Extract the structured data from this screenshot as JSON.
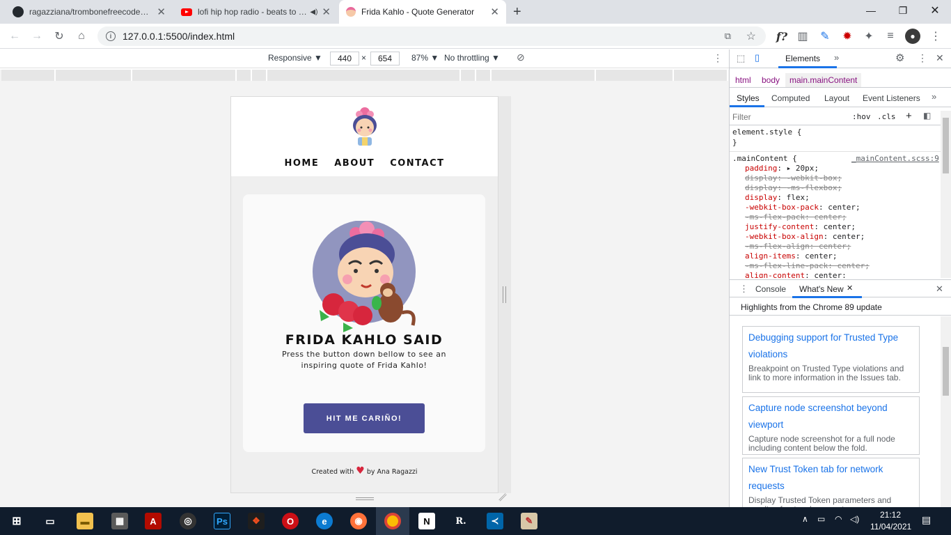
{
  "browser": {
    "tabs": [
      {
        "title": "ragazziana/trombonefreecodecamp",
        "icon": "github-icon"
      },
      {
        "title": "lofi hip hop radio - beats to relax/study to",
        "icon": "youtube-icon"
      },
      {
        "title": "Frida Kahlo - Quote Generator",
        "icon": "frida-favicon",
        "active": true
      }
    ],
    "new_tab": "+",
    "url": "127.0.0.1:5500/index.html",
    "ext_f": "f?"
  },
  "device_toolbar": {
    "mode": "Responsive ▼",
    "width": "440",
    "times": "×",
    "height": "654",
    "zoom": "87% ▼",
    "throttle": "No throttling ▼"
  },
  "page": {
    "nav": [
      "HOME",
      "ABOUT",
      "CONTACT"
    ],
    "heading": "FRIDA KAHLO SAID",
    "description": "Press the button down bellow to see an inspiring quote of Frida Kahlo!",
    "button": "HIT ME CARIÑO!",
    "footer_before": "Created with",
    "footer_after": "by Ana Ragazzi"
  },
  "devtools": {
    "main_tab": "Elements",
    "breadcrumb": [
      "html",
      "body",
      "main.mainContent"
    ],
    "subtabs": [
      "Styles",
      "Computed",
      "Layout",
      "Event Listeners"
    ],
    "filter_placeholder": "Filter",
    "hov": ":hov",
    "cls": ".cls",
    "element_style": "element.style {",
    "close_brace": "}",
    "rule_selector": ".mainContent {",
    "rule_source": "_mainContent.scss:9",
    "declarations": [
      {
        "prop": "padding",
        "value": "▸ 20px;",
        "struck": false
      },
      {
        "prop": "display",
        "value": "-webkit-box;",
        "struck": true
      },
      {
        "prop": "display",
        "value": "-ms-flexbox;",
        "struck": true
      },
      {
        "prop": "display",
        "value": "flex;",
        "struck": false
      },
      {
        "prop": "-webkit-box-pack",
        "value": "center;",
        "struck": false
      },
      {
        "prop": "-ms-flex-pack",
        "value": "center;",
        "struck": true
      },
      {
        "prop": "justify-content",
        "value": "center;",
        "struck": false
      },
      {
        "prop": "-webkit-box-align",
        "value": "center;",
        "struck": false
      },
      {
        "prop": "-ms-flex-align",
        "value": "center;",
        "struck": true
      },
      {
        "prop": "align-items",
        "value": "center;",
        "struck": false
      },
      {
        "prop": "-ms-flex-line-pack",
        "value": "center;",
        "struck": true
      },
      {
        "prop": "align-content",
        "value": "center;",
        "struck": false
      }
    ],
    "drawer_tabs": [
      "Console",
      "What's New"
    ],
    "highlights": "Highlights from the Chrome 89 update",
    "cards": [
      {
        "title": "Debugging support for Trusted Type violations",
        "desc": "Breakpoint on Trusted Type violations and link to more information in the Issues tab."
      },
      {
        "title": "Capture node screenshot beyond viewport",
        "desc": "Capture node screenshot for a full node including content below the fold."
      },
      {
        "title": "New Trust Token tab for network requests",
        "desc": "Display Trusted Token parameters and results of network requests."
      }
    ]
  },
  "taskbar": {
    "time": "21:12",
    "date": "11/04/2021"
  },
  "colors": {
    "accent": "#4b4e96",
    "link": "#1a73e8",
    "taskbar": "#101c2c"
  }
}
